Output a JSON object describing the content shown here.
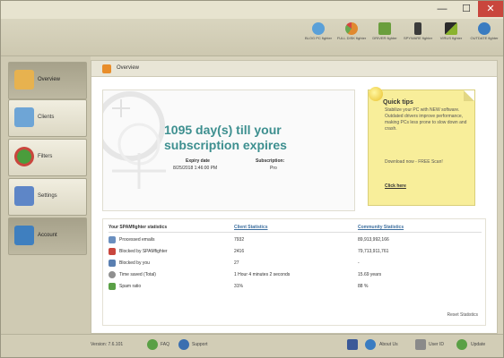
{
  "window": {
    "controls": {
      "minimize": "—",
      "maximize": "☐",
      "close": "✕"
    }
  },
  "toolbar": {
    "tools": [
      {
        "label": "BLOG PC fighter",
        "icon": "clock-gauge-icon",
        "color": "#5aa0d8"
      },
      {
        "label": "FULL DISK fighter",
        "icon": "disk-pie-icon",
        "color": "#e0892f"
      },
      {
        "label": "DRIVER fighter",
        "icon": "driver-gear-icon",
        "color": "#6a9e3d"
      },
      {
        "label": "SPYWARE fighter",
        "icon": "spyware-icon",
        "color": "#3b3b3b"
      },
      {
        "label": "VIRUS fighter",
        "icon": "virus-icon",
        "color": "#8ab32e"
      },
      {
        "label": "OUTDATE fighter",
        "icon": "outdate-icon",
        "color": "#3a7cc1"
      }
    ]
  },
  "sidebar": {
    "items": [
      {
        "label": "Overview",
        "icon": "overview-icon",
        "color": "#e7b24f",
        "active": true
      },
      {
        "label": "Clients",
        "icon": "clients-icon",
        "color": "#6ea5d6",
        "active": false
      },
      {
        "label": "Filters",
        "icon": "filters-icon",
        "color": "#4a9d3c",
        "active": false
      },
      {
        "label": "Settings",
        "icon": "settings-icon",
        "color": "#5e86c7",
        "active": false
      },
      {
        "label": "Account",
        "icon": "account-icon",
        "color": "#3f7fbf",
        "active": true
      }
    ]
  },
  "content": {
    "title": "Overview",
    "subscription": {
      "headline": "1095 day(s) till your subscription expires",
      "expiry_label": "Expiry date",
      "expiry_value": "8/25/2018 1:46:00 PM",
      "sub_label": "Subscription:",
      "sub_value": "Pro"
    },
    "quick_tips": {
      "title": "Quick tips",
      "text": "Stabilize your PC with NEW software. Outdated drivers improve performance, making PCs less prone to slow down and crash.",
      "download": "Download now - FREE Scan!",
      "link": "Click here"
    },
    "stats": {
      "heading": "Your SPAMfighter statistics",
      "client_heading": "Client Statistics",
      "community_heading": "Community Statistics",
      "rows": [
        {
          "name": "Processed emails",
          "client": "7932",
          "community": "89,913,992,166",
          "icon": "mail-icon",
          "color": "#6a8fbf"
        },
        {
          "name": "Blocked by SPAMfighter",
          "client": "2416",
          "community": "79,713,911,761",
          "icon": "block-icon",
          "color": "#c9463d"
        },
        {
          "name": "Blocked by you",
          "client": "27",
          "community": "-",
          "icon": "user-block-icon",
          "color": "#5a7fb1"
        },
        {
          "name": "Time saved (Total)",
          "client": "1 Hour 4 minutes 2 seconds",
          "community": "15.69 years",
          "icon": "clock-icon",
          "color": "#8f8f8f"
        },
        {
          "name": "Spam ratio",
          "client": "31%",
          "community": "88 %",
          "icon": "check-icon",
          "color": "#5aa046"
        }
      ],
      "reset": "Reset Statistics"
    }
  },
  "statusbar": {
    "version": "Version: 7.6.101",
    "faq": "FAQ",
    "support": "Support",
    "about": "About Us",
    "user_id": "User ID",
    "update": "Update"
  }
}
